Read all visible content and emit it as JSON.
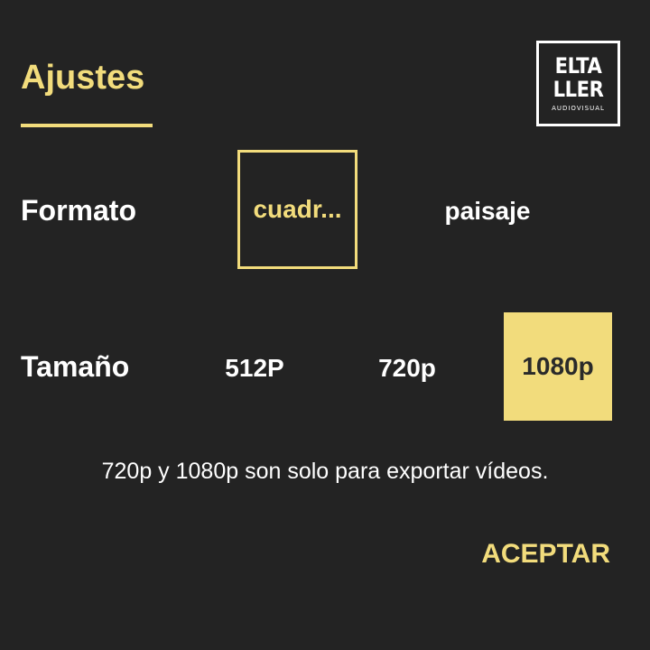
{
  "dialog": {
    "title": "Ajustes",
    "logo": {
      "line1": "ELTA",
      "line2": "LLER",
      "subtitle": "AUDIOVISUAL"
    },
    "format": {
      "label": "Formato",
      "options": [
        {
          "label": "cuadr...",
          "selected": true
        },
        {
          "label": "paisaje",
          "selected": false
        }
      ]
    },
    "size": {
      "label": "Tamaño",
      "options": [
        {
          "label": "512P",
          "selected": false
        },
        {
          "label": "720p",
          "selected": false
        },
        {
          "label": "1080p",
          "selected": true
        }
      ]
    },
    "note": "720p y 1080p son solo para exportar vídeos.",
    "accept_label": "ACEPTAR"
  },
  "colors": {
    "background": "#232323",
    "accent": "#f2dc7c",
    "text": "#ffffff"
  }
}
